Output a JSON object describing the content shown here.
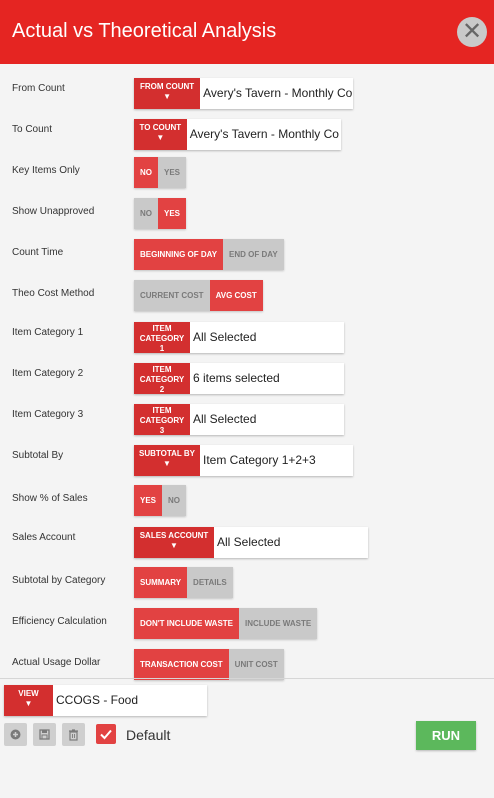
{
  "header": {
    "title": "Actual vs Theoretical Analysis",
    "close_glyph": "✕"
  },
  "fields": {
    "from_count": {
      "label": "From Count",
      "button": "FROM COUNT",
      "value": "Avery's Tavern - Monthly Co"
    },
    "to_count": {
      "label": "To Count",
      "button": "TO COUNT",
      "value": "Avery's Tavern - Monthly Co"
    },
    "key_items_only": {
      "label": "Key Items Only",
      "options": [
        "NO",
        "YES"
      ],
      "selected": "NO"
    },
    "show_unapproved": {
      "label": "Show Unapproved",
      "options": [
        "NO",
        "YES"
      ],
      "selected": "YES"
    },
    "count_time": {
      "label": "Count Time",
      "options": [
        "BEGINNING OF DAY",
        "END OF DAY"
      ],
      "selected": "BEGINNING OF DAY"
    },
    "theo_cost_method": {
      "label": "Theo Cost Method",
      "options": [
        "CURRENT COST",
        "AVG COST"
      ],
      "selected": "AVG COST"
    },
    "item_category_1": {
      "label": "Item Category 1",
      "button": "ITEM CATEGORY 1",
      "value": "All Selected"
    },
    "item_category_2": {
      "label": "Item Category 2",
      "button": "ITEM CATEGORY 2",
      "value": "6 items selected"
    },
    "item_category_3": {
      "label": "Item Category 3",
      "button": "ITEM CATEGORY 3",
      "value": "All Selected"
    },
    "subtotal_by": {
      "label": "Subtotal By",
      "button": "SUBTOTAL BY",
      "value": "Item Category 1+2+3"
    },
    "show_pct_sales": {
      "label": "Show % of Sales",
      "options": [
        "YES",
        "NO"
      ],
      "selected": "YES"
    },
    "sales_account": {
      "label": "Sales Account",
      "button": "SALES ACCOUNT",
      "value": "All Selected"
    },
    "subtotal_by_category": {
      "label": "Subtotal by Category",
      "options": [
        "SUMMARY",
        "DETAILS"
      ],
      "selected": "SUMMARY"
    },
    "efficiency_calculation": {
      "label": "Efficiency Calculation",
      "options": [
        "DON'T INCLUDE WASTE",
        "INCLUDE WASTE"
      ],
      "selected": "DON'T INCLUDE WASTE"
    },
    "actual_usage_dollar": {
      "label": "Actual Usage Dollar",
      "options": [
        "TRANSACTION COST",
        "UNIT COST"
      ],
      "selected": "TRANSACTION COST"
    }
  },
  "footer": {
    "view_button": "VIEW",
    "view_value": "CCOGS - Food",
    "default_label": "Default",
    "default_checked": true,
    "run_label": "RUN",
    "icons": [
      "plus-circle-icon",
      "save-icon",
      "trash-icon"
    ]
  },
  "colors": {
    "header": "#e52522",
    "accent": "#e24242",
    "run": "#5cb85c",
    "inactive": "#c9c9c9"
  }
}
